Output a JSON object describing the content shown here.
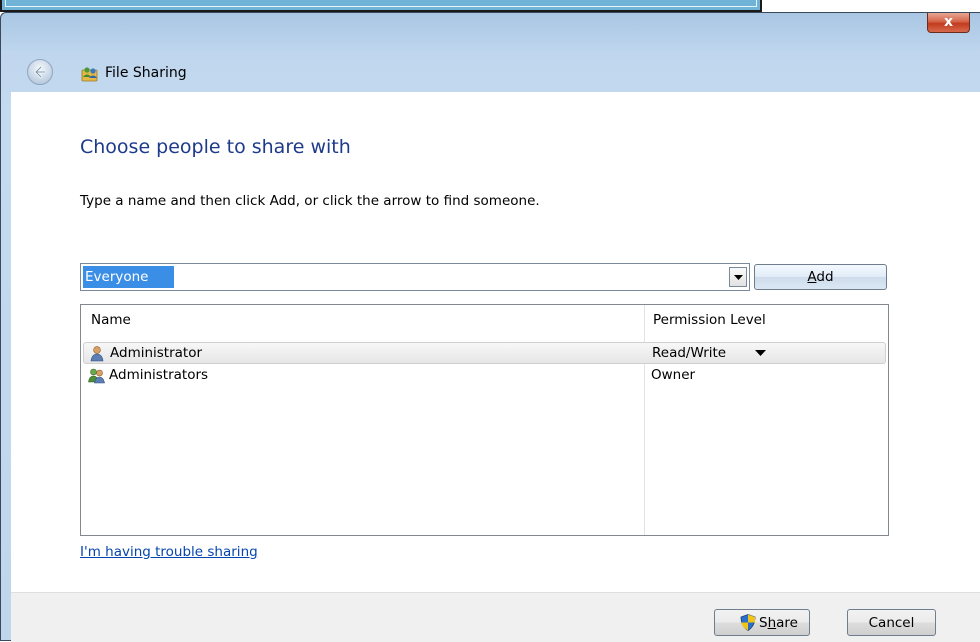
{
  "window": {
    "title": "File Sharing",
    "close_label": "x",
    "colors": {
      "heading": "#1e3a8a",
      "link": "#0645ad",
      "selection": "#3b8ee6",
      "close": "#c23b1e"
    }
  },
  "icons": {
    "back": "back-arrow-icon",
    "title": "file-sharing-people-icon",
    "user": "user-icon",
    "group": "user-group-icon",
    "shield": "uac-shield-icon"
  },
  "main": {
    "heading": "Choose people to share with",
    "instruction": "Type a name and then click Add, or click the arrow to find someone.",
    "name_input_value": "Everyone",
    "add_button": {
      "prefix": "",
      "underline": "A",
      "suffix": "dd"
    },
    "list": {
      "columns": {
        "name": "Name",
        "permission": "Permission Level"
      },
      "rows": [
        {
          "name": "Administrator",
          "permission": "Read/Write",
          "has_dropdown": true,
          "selected": true
        },
        {
          "name": "Administrators",
          "permission": "Owner",
          "has_dropdown": false,
          "selected": false
        }
      ]
    },
    "trouble_link": "I'm having trouble sharing"
  },
  "footer": {
    "share_button": {
      "prefix": "S",
      "underline": "h",
      "suffix": "are"
    },
    "cancel_label": "Cancel"
  }
}
